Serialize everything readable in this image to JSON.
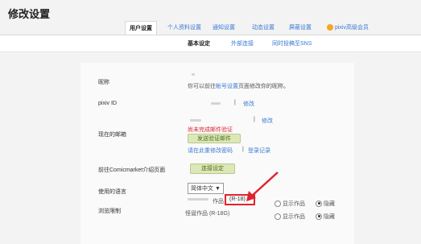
{
  "page": {
    "title": "修改设置"
  },
  "tabs": [
    {
      "label": "用户设置"
    },
    {
      "label": "个人资料设置"
    },
    {
      "label": "通知设置"
    },
    {
      "label": "动态设置"
    },
    {
      "label": "屏蔽设置"
    },
    {
      "label": "pixiv高级会员"
    }
  ],
  "subtabs": [
    {
      "label": "基本设定"
    },
    {
      "label": "外部连接"
    },
    {
      "label": "同时投稿至SNS"
    }
  ],
  "form": {
    "nickname": {
      "label": "昵称",
      "hint_prefix": "你可以前往",
      "hint_link": "帐号设置",
      "hint_suffix": "页面修改你的昵称。"
    },
    "pixiv_id": {
      "label": "pixiv ID",
      "separator": "|",
      "edit": "修改"
    },
    "email": {
      "label": "现在的邮箱",
      "separator": "|",
      "edit": "修改",
      "unverified": "尚未完成邮件验证",
      "send_button": "发送验证邮件",
      "confirm_link": "请在此重修改密码",
      "separator2": "|",
      "login_history": "登录记录"
    },
    "comicmarket": {
      "label": "前往Comicmarket介绍页面",
      "button": "连接设定"
    },
    "language": {
      "label": "使用的语言",
      "selected": "简体中文",
      "arrow": "▼"
    },
    "filter": {
      "label": "浏览限制",
      "row1_text": "作品",
      "row1_badge": "(R-18)",
      "row2_text": "怪诞作品 (R-18G)",
      "show": "显示作品",
      "hide": "隐藏",
      "row1_value": "隐藏",
      "row2_value": "隐藏"
    }
  },
  "colors": {
    "accent": "#3a7bd5",
    "annotation": "#e0242e",
    "button": "#dde8b8"
  }
}
